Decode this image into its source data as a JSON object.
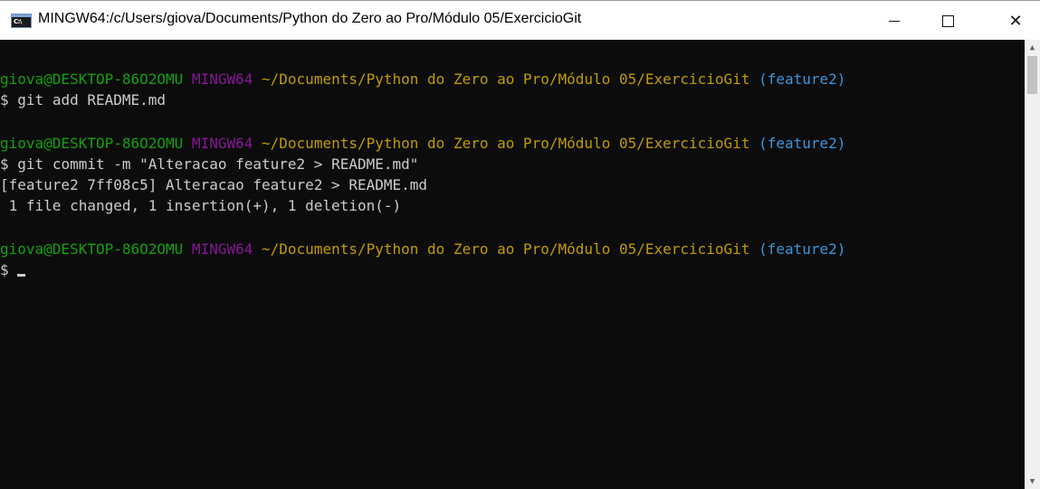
{
  "window": {
    "title": "MINGW64:/c/Users/giova/Documents/Python do Zero ao Pro/Módulo 05/ExercicioGit",
    "icon_label": "C:\\",
    "minimize_glyph": "—",
    "close_glyph": "✕"
  },
  "prompt": {
    "user_host": "giova@DESKTOP-86O2OMU",
    "env": "MINGW64",
    "path": "~/Documents/Python do Zero ao Pro/Módulo 05/ExercicioGit",
    "branch": "(feature2)",
    "symbol": "$"
  },
  "terminal": {
    "cmd1": "git add README.md",
    "cmd2": "git commit -m \"Alteracao feature2 > README.md\"",
    "out1": "[feature2 7ff08c5] Alteracao feature2 > README.md",
    "out2": " 1 file changed, 1 insertion(+), 1 deletion(-)"
  },
  "colors": {
    "background": "#0c0c0c",
    "user_host": "#13a10e",
    "env": "#881798",
    "path": "#c19c00",
    "branch": "#3a96dd",
    "text": "#cccccc"
  },
  "icons": {
    "app": "terminal-app-icon",
    "minimize": "minimize-icon",
    "maximize": "maximize-icon",
    "close": "close-icon"
  }
}
